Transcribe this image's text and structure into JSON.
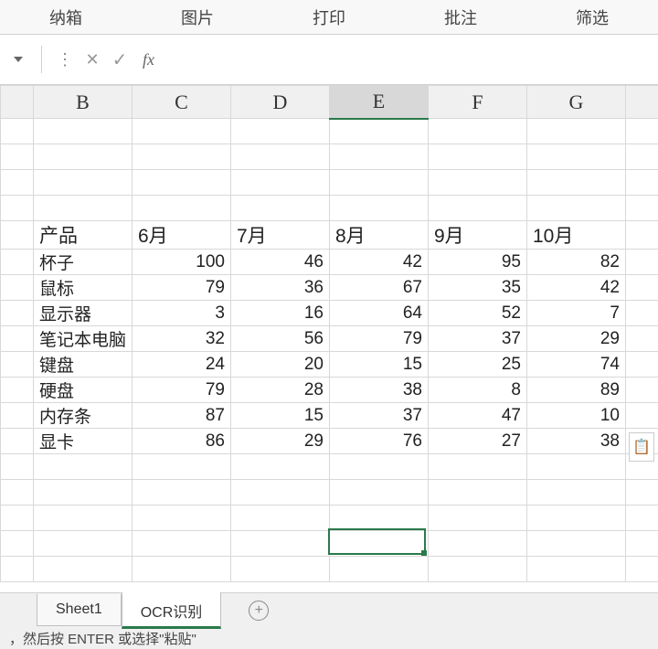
{
  "ribbon": {
    "store": "纳箱",
    "picture": "图片",
    "print": "打印",
    "comment": "批注",
    "filter": "筛选"
  },
  "formula_bar": {
    "fx_label": "fx",
    "input_value": ""
  },
  "columns": {
    "A": "",
    "B": "B",
    "C": "C",
    "D": "D",
    "E": "E",
    "F": "F",
    "G": "G"
  },
  "selected_col": "E",
  "header_row": {
    "product": "产品",
    "m6": "6月",
    "m7": "7月",
    "m8": "8月",
    "m9": "9月",
    "m10": "10月"
  },
  "rows": [
    {
      "name": "杯子",
      "c": "100",
      "d": "46",
      "e": "42",
      "f": "95",
      "g": "82"
    },
    {
      "name": "鼠标",
      "c": "79",
      "d": "36",
      "e": "67",
      "f": "35",
      "g": "42"
    },
    {
      "name": "显示器",
      "c": "3",
      "d": "16",
      "e": "64",
      "f": "52",
      "g": "7"
    },
    {
      "name": "笔记本电脑",
      "c": "32",
      "d": "56",
      "e": "79",
      "f": "37",
      "g": "29"
    },
    {
      "name": "键盘",
      "c": "24",
      "d": "20",
      "e": "15",
      "f": "25",
      "g": "74"
    },
    {
      "name": "硬盘",
      "c": "79",
      "d": "28",
      "e": "38",
      "f": "8",
      "g": "89"
    },
    {
      "name": "内存条",
      "c": "87",
      "d": "15",
      "e": "37",
      "f": "47",
      "g": "10"
    },
    {
      "name": "显卡",
      "c": "86",
      "d": "29",
      "e": "76",
      "f": "27",
      "g": "38"
    }
  ],
  "tabs": {
    "sheet1": "Sheet1",
    "ocr": "OCR识别"
  },
  "status": {
    "text": "，然后按 ENTER 或选择\"粘贴\""
  },
  "paste_icon": "📋",
  "chart_data": {
    "type": "table",
    "title": "",
    "columns": [
      "产品",
      "6月",
      "7月",
      "8月",
      "9月",
      "10月"
    ],
    "data": [
      [
        "杯子",
        100,
        46,
        42,
        95,
        82
      ],
      [
        "鼠标",
        79,
        36,
        67,
        35,
        42
      ],
      [
        "显示器",
        3,
        16,
        64,
        52,
        7
      ],
      [
        "笔记本电脑",
        32,
        56,
        79,
        37,
        29
      ],
      [
        "键盘",
        24,
        20,
        15,
        25,
        74
      ],
      [
        "硬盘",
        79,
        28,
        38,
        8,
        89
      ],
      [
        "内存条",
        87,
        15,
        37,
        47,
        10
      ],
      [
        "显卡",
        86,
        29,
        76,
        27,
        38
      ]
    ]
  }
}
